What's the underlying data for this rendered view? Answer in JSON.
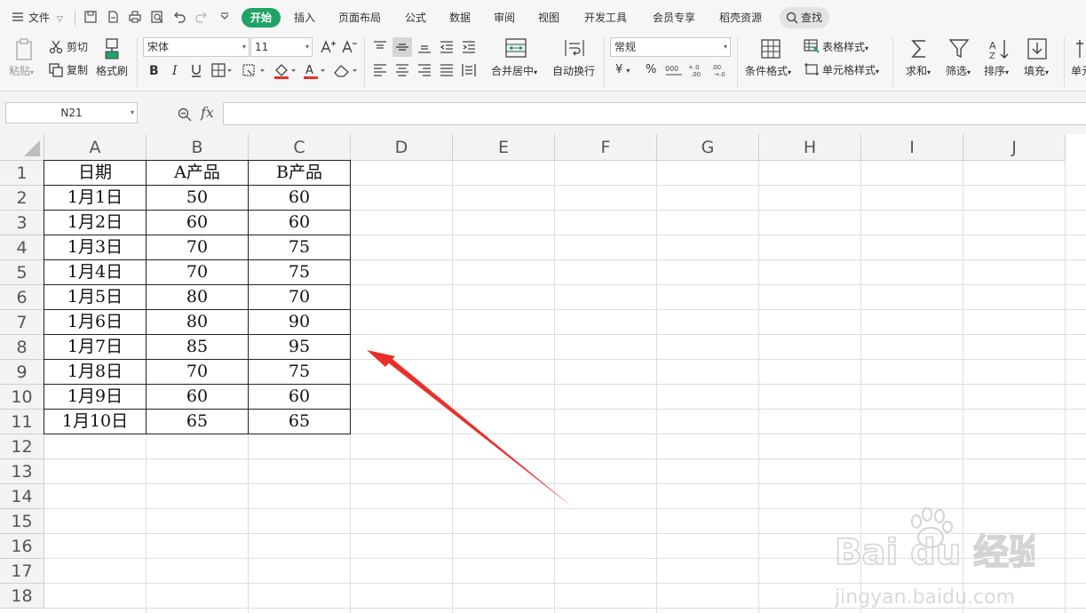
{
  "menu": {
    "file_label": "文件",
    "tabs": [
      "开始",
      "插入",
      "页面布局",
      "公式",
      "数据",
      "审阅",
      "视图",
      "开发工具",
      "会员专享",
      "稻壳资源"
    ],
    "search_label": "查找"
  },
  "ribbon": {
    "paste": "粘贴",
    "cut": "剪切",
    "copy": "复制",
    "format_painter": "格式刷",
    "font_name": "宋体",
    "font_size": "11",
    "merge_center": "合并居中",
    "wrap_text": "自动换行",
    "number_format": "常规",
    "table_style": "表格样式",
    "cell_style": "单元格样式",
    "conditional_format": "条件格式",
    "sum": "求和",
    "filter": "筛选",
    "sort": "排序",
    "fill": "填充",
    "cell_partial": "单元"
  },
  "formula_bar": {
    "name_box": "N21",
    "fx": "fx",
    "formula": ""
  },
  "sheet": {
    "columns": [
      "A",
      "B",
      "C",
      "D",
      "E",
      "F",
      "G",
      "H",
      "I",
      "J"
    ],
    "rows": [
      "1",
      "2",
      "3",
      "4",
      "5",
      "6",
      "7",
      "8",
      "9",
      "10",
      "11",
      "12",
      "13",
      "14",
      "15",
      "16",
      "17",
      "18"
    ],
    "headers": [
      "日期",
      "A产品",
      "B产品"
    ],
    "data": [
      [
        "1月1日",
        "50",
        "60"
      ],
      [
        "1月2日",
        "60",
        "60"
      ],
      [
        "1月3日",
        "70",
        "75"
      ],
      [
        "1月4日",
        "70",
        "75"
      ],
      [
        "1月5日",
        "80",
        "70"
      ],
      [
        "1月6日",
        "80",
        "90"
      ],
      [
        "1月7日",
        "85",
        "95"
      ],
      [
        "1月8日",
        "70",
        "75"
      ],
      [
        "1月9日",
        "60",
        "60"
      ],
      [
        "1月10日",
        "65",
        "65"
      ]
    ]
  },
  "watermark": {
    "brand": "Bai du 经验",
    "url": "jingyan.baidu.com"
  },
  "colors": {
    "accent": "#21a366",
    "arrow": "#e8302a",
    "grid": "#dedede"
  }
}
